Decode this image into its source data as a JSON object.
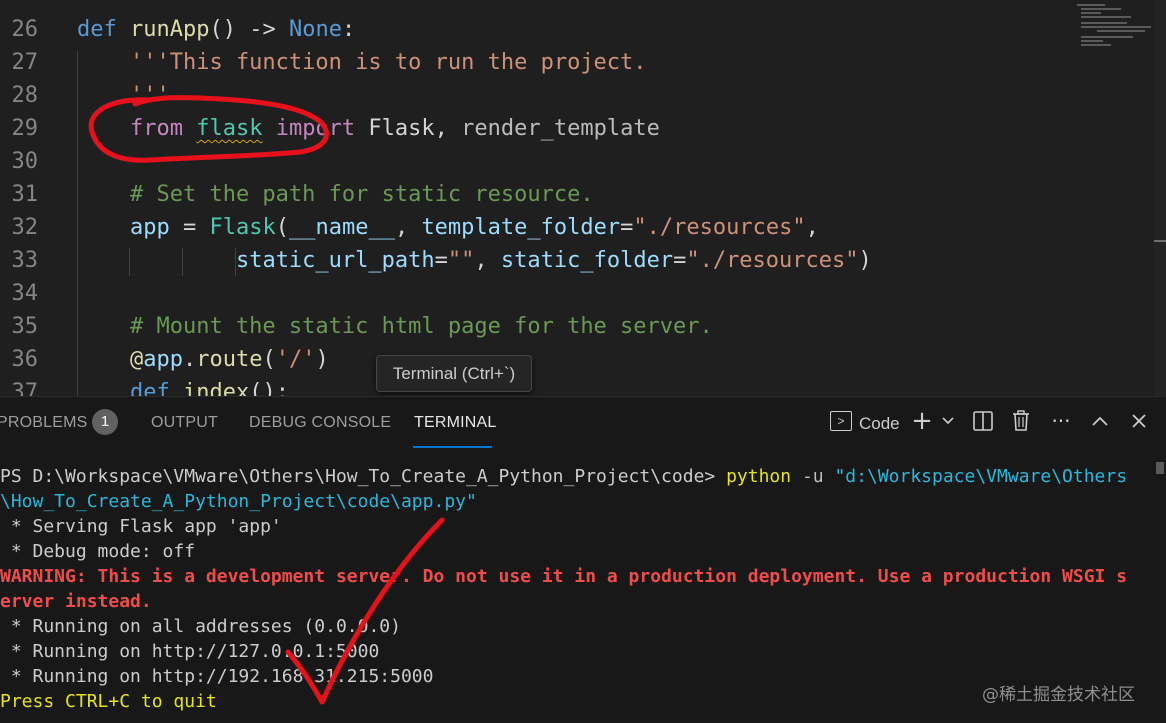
{
  "editor": {
    "lines": [
      {
        "num": "26",
        "segments": [
          {
            "t": "def ",
            "c": "kw"
          },
          {
            "t": "runApp",
            "c": "fn"
          },
          {
            "t": "() -> ",
            "c": "txt"
          },
          {
            "t": "None",
            "c": "kw"
          },
          {
            "t": ":",
            "c": "txt"
          }
        ]
      },
      {
        "num": "27",
        "segments": [
          {
            "t": "    '''This function is to run the project.",
            "c": "str"
          }
        ]
      },
      {
        "num": "28",
        "segments": [
          {
            "t": "    '''",
            "c": "str"
          }
        ]
      },
      {
        "num": "29",
        "segments": [
          {
            "t": "    ",
            "c": "txt"
          },
          {
            "t": "from",
            "c": "ctl"
          },
          {
            "t": " ",
            "c": "txt"
          },
          {
            "t": "flask",
            "c": "cls",
            "squiggle": true
          },
          {
            "t": " ",
            "c": "txt"
          },
          {
            "t": "import",
            "c": "ctl"
          },
          {
            "t": " Flask, ",
            "c": "txt"
          },
          {
            "t": "render_template",
            "c": "dim"
          }
        ]
      },
      {
        "num": "30",
        "segments": []
      },
      {
        "num": "31",
        "segments": [
          {
            "t": "    # Set the path for static resource.",
            "c": "cm"
          }
        ]
      },
      {
        "num": "32",
        "segments": [
          {
            "t": "    ",
            "c": "txt"
          },
          {
            "t": "app",
            "c": "var"
          },
          {
            "t": " = ",
            "c": "txt"
          },
          {
            "t": "Flask",
            "c": "cls"
          },
          {
            "t": "(",
            "c": "txt"
          },
          {
            "t": "__name__",
            "c": "var"
          },
          {
            "t": ", ",
            "c": "txt"
          },
          {
            "t": "template_folder",
            "c": "var"
          },
          {
            "t": "=",
            "c": "txt"
          },
          {
            "t": "\"./resources\"",
            "c": "str"
          },
          {
            "t": ",",
            "c": "txt"
          }
        ]
      },
      {
        "num": "33",
        "segments": [
          {
            "t": "            ",
            "c": "txt"
          },
          {
            "t": "static_url_path",
            "c": "var"
          },
          {
            "t": "=",
            "c": "txt"
          },
          {
            "t": "\"\"",
            "c": "str"
          },
          {
            "t": ", ",
            "c": "txt"
          },
          {
            "t": "static_folder",
            "c": "var"
          },
          {
            "t": "=",
            "c": "txt"
          },
          {
            "t": "\"./resources\"",
            "c": "str"
          },
          {
            "t": ")",
            "c": "txt"
          }
        ]
      },
      {
        "num": "34",
        "segments": []
      },
      {
        "num": "35",
        "segments": [
          {
            "t": "    # Mount the static html page for the server.",
            "c": "cm"
          }
        ]
      },
      {
        "num": "36",
        "segments": [
          {
            "t": "    ",
            "c": "txt"
          },
          {
            "t": "@",
            "c": "fn"
          },
          {
            "t": "app",
            "c": "var"
          },
          {
            "t": ".",
            "c": "txt"
          },
          {
            "t": "route",
            "c": "fn"
          },
          {
            "t": "(",
            "c": "txt"
          },
          {
            "t": "'/'",
            "c": "str"
          },
          {
            "t": ")",
            "c": "txt"
          }
        ]
      },
      {
        "num": "37",
        "segments": [
          {
            "t": "    ",
            "c": "txt"
          },
          {
            "t": "def",
            "c": "kw"
          },
          {
            "t": " ",
            "c": "txt"
          },
          {
            "t": "index",
            "c": "fn"
          },
          {
            "t": "():",
            "c": "txt"
          }
        ]
      }
    ]
  },
  "tooltip": {
    "text": "Terminal (Ctrl+`)"
  },
  "panel": {
    "tabs": {
      "problems": "PROBLEMS",
      "problems_count": "1",
      "output": "OUTPUT",
      "debug_console": "DEBUG CONSOLE",
      "terminal": "TERMINAL"
    },
    "actions": {
      "profile_label": "Code",
      "new_terminal_icon": "plus-icon",
      "launch_profile_icon": "chevron-down-icon",
      "split_icon": "split-icon",
      "kill_icon": "trash-icon",
      "more_icon": "ellipsis-icon",
      "maximize_icon": "chevron-up-icon",
      "close_icon": "close-icon"
    }
  },
  "terminal": {
    "lines": [
      {
        "segments": [
          {
            "t": "PS D:\\Workspace\\VMware\\Others\\How_To_Create_A_Python_Project\\code> ",
            "c": "t-white"
          },
          {
            "t": "python",
            "c": "t-yellow"
          },
          {
            "t": " -u ",
            "c": "t-gray"
          },
          {
            "t": "\"d:\\Workspace\\VMware\\Others",
            "c": "t-cyan"
          }
        ]
      },
      {
        "segments": [
          {
            "t": "\\How_To_Create_A_Python_Project\\code\\app.py\"",
            "c": "t-cyan"
          }
        ]
      },
      {
        "segments": [
          {
            "t": " * Serving Flask app 'app'",
            "c": "t-white"
          }
        ]
      },
      {
        "segments": [
          {
            "t": " * Debug mode: off",
            "c": "t-white"
          }
        ]
      },
      {
        "segments": [
          {
            "t": "WARNING: This is a development server. Do not use it in a production deployment. Use a production WSGI s",
            "c": "t-red"
          }
        ]
      },
      {
        "segments": [
          {
            "t": "erver instead.",
            "c": "t-red"
          }
        ]
      },
      {
        "segments": [
          {
            "t": " * Running on all addresses (0.0.0.0)",
            "c": "t-white"
          }
        ]
      },
      {
        "segments": [
          {
            "t": " * Running on http://127.0.0.1:5000",
            "c": "t-white"
          }
        ]
      },
      {
        "segments": [
          {
            "t": " * Running on http://192.168.31.215:5000",
            "c": "t-white"
          }
        ]
      },
      {
        "segments": [
          {
            "t": "Press CTRL+C to quit",
            "c": "t-bold-yellow"
          }
        ]
      }
    ]
  },
  "watermark": "@稀土掘金技术社区"
}
